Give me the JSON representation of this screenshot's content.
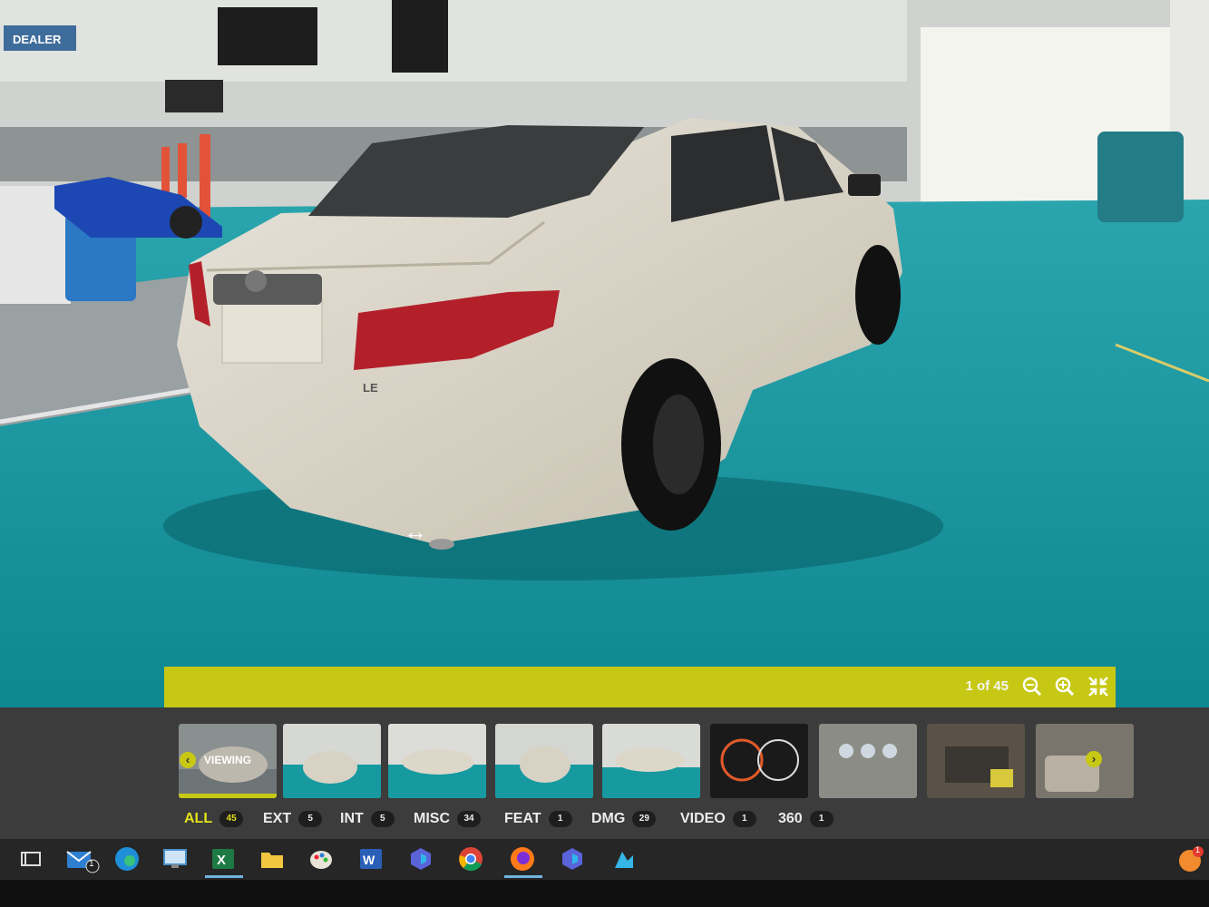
{
  "viewer": {
    "counter": "1 of 45",
    "zoom_out_icon": "zoom-out-icon",
    "zoom_in_icon": "zoom-in-icon",
    "collapse_icon": "collapse-icon",
    "pan_cursor_icon": "hand-pan-icon"
  },
  "photo_text": {
    "sign": "DEALER",
    "trunk_badge": "LE"
  },
  "thumbnails": {
    "viewing_label": "VIEWING",
    "prev_icon": "chevron-left-icon",
    "next_icon": "chevron-right-icon"
  },
  "categories": [
    {
      "label": "ALL",
      "count": "45"
    },
    {
      "label": "EXT",
      "count": "5"
    },
    {
      "label": "INT",
      "count": "5"
    },
    {
      "label": "MISC",
      "count": "34"
    },
    {
      "label": "FEAT",
      "count": "1"
    },
    {
      "label": "DMG",
      "count": "29"
    },
    {
      "label": "VIDEO",
      "count": "1"
    },
    {
      "label": "360",
      "count": "1"
    }
  ],
  "taskbar": {
    "mail_badge": "1",
    "tray_badge": "1",
    "icons": [
      "task-view-icon",
      "mail-icon",
      "edge-icon",
      "remote-desktop-icon",
      "excel-icon",
      "file-explorer-icon",
      "paint-icon",
      "word-icon",
      "copilot-icon",
      "chrome-icon",
      "firefox-icon",
      "copilot-icon",
      "app-icon",
      "notification-icon"
    ]
  },
  "colors": {
    "accent_yellow": "#c7c814",
    "floor_teal": "#14939a",
    "car_silver": "#d9d3c6"
  }
}
